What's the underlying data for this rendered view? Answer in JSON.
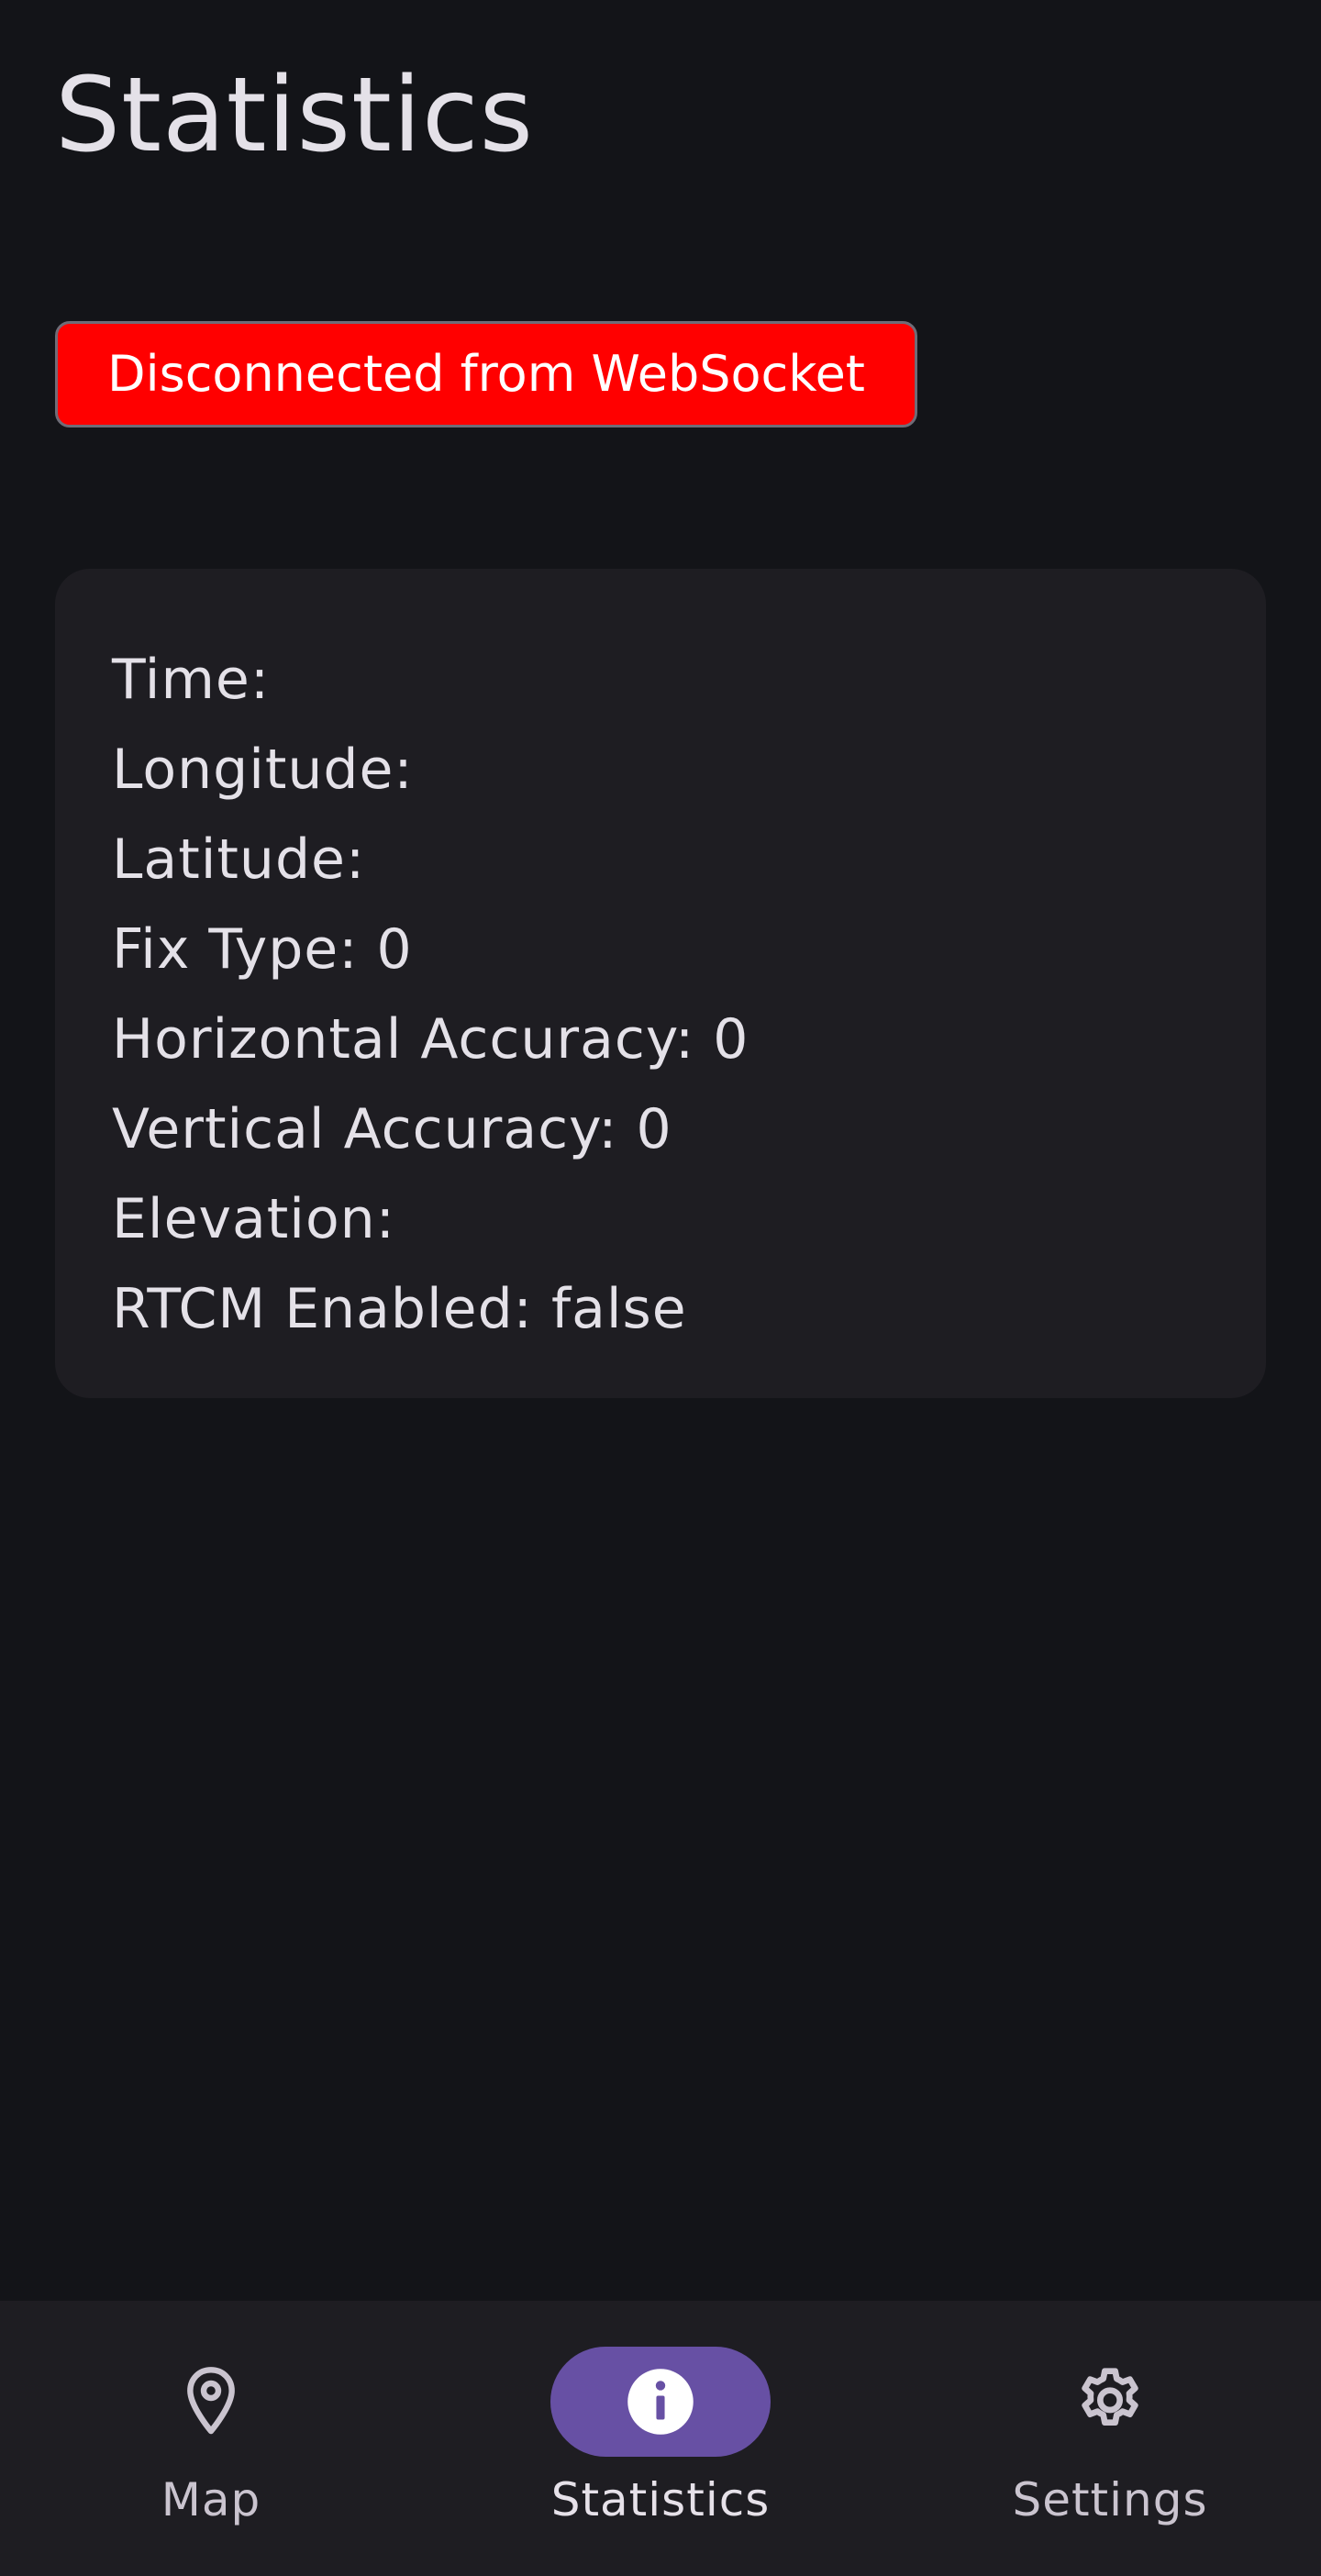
{
  "page": {
    "title": "Statistics"
  },
  "connection": {
    "status_text": "Disconnected from WebSocket",
    "status_color": "#ff0000"
  },
  "stats": [
    {
      "label": "Time:",
      "value": ""
    },
    {
      "label": "Longitude:",
      "value": ""
    },
    {
      "label": "Latitude:",
      "value": ""
    },
    {
      "label": "Fix Type:",
      "value": "0"
    },
    {
      "label": "Horizontal Accuracy:",
      "value": "0"
    },
    {
      "label": "Vertical Accuracy:",
      "value": "0"
    },
    {
      "label": "Elevation:",
      "value": ""
    },
    {
      "label": "RTCM Enabled:",
      "value": "false"
    }
  ],
  "nav": {
    "items": [
      {
        "label": "Map",
        "icon": "map-pin-icon",
        "active": false
      },
      {
        "label": "Statistics",
        "icon": "info-icon",
        "active": true
      },
      {
        "label": "Settings",
        "icon": "gear-icon",
        "active": false
      }
    ],
    "active_color": "#6750a4"
  }
}
